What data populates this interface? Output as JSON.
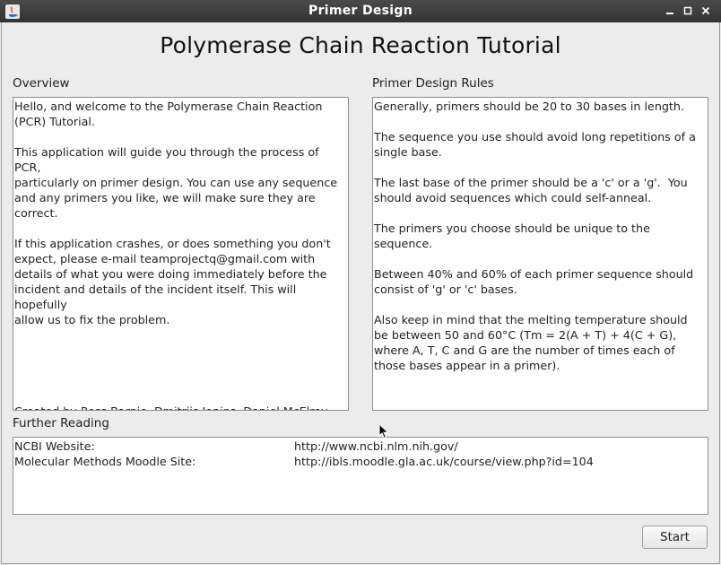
{
  "window": {
    "title": "Primer Design"
  },
  "heading": "Polymerase Chain Reaction Tutorial",
  "overview": {
    "label": "Overview",
    "text": "Hello, and welcome to the Polymerase Chain Reaction\n(PCR) Tutorial.\n\nThis application will guide you through the process of PCR,\nparticularly on primer design. You can use any sequence\nand any primers you like, we will make sure they are\ncorrect.\n\nIf this application crashes, or does something you don't\nexpect, please e-mail teamprojectq@gmail.com with\ndetails of what you were doing immediately before the\nincident and details of the incident itself. This will hopefully\nallow us to fix the problem.\n\n\n\n\n\nCreated by Ross Barnie, Dmitrijs Jonins, Daniel McElroy,\nMurray Ross and Ross Taylor."
  },
  "rules": {
    "label": "Primer Design Rules",
    "text": "Generally, primers should be 20 to 30 bases in length.\n\nThe sequence you use should avoid long repetitions of a\nsingle base.\n\nThe last base of the primer should be a 'c' or a 'g'.  You\nshould avoid sequences which could self-anneal.\n\nThe primers you choose should be unique to the\nsequence.\n\nBetween 40% and 60% of each primer sequence should\nconsist of 'g' or 'c' bases.\n\nAlso keep in mind that the melting temperature should\nbe between 50 and 60°C (Tm = 2(A + T) + 4(C + G),\nwhere A, T, C and G are the number of times each of\nthose bases appear in a primer)."
  },
  "further_reading": {
    "label": "Further Reading",
    "rows": [
      {
        "name": "NCBI Website:",
        "url": "http://www.ncbi.nlm.nih.gov/"
      },
      {
        "name": "Molecular Methods Moodle Site:",
        "url": "http://ibls.moodle.gla.ac.uk/course/view.php?id=104"
      }
    ]
  },
  "buttons": {
    "start": "Start"
  },
  "icons": {
    "app": "java-app-icon",
    "minimize": "minimize-icon",
    "maximize": "maximize-icon",
    "close": "close-icon"
  }
}
